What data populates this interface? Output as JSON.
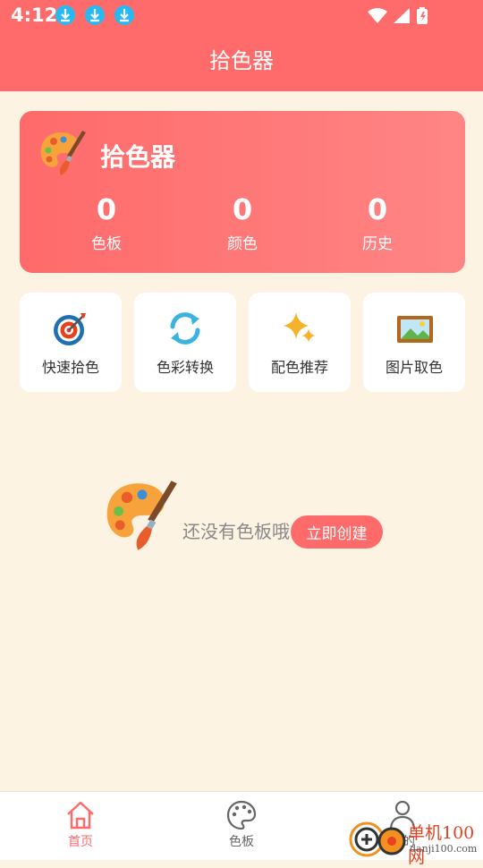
{
  "status_bar": {
    "time": "4:12"
  },
  "app_bar": {
    "title": "拾色器"
  },
  "hero": {
    "title": "拾色器",
    "stats": [
      {
        "value": "0",
        "label": "色板"
      },
      {
        "value": "0",
        "label": "颜色"
      },
      {
        "value": "0",
        "label": "历史"
      }
    ]
  },
  "quick_actions": [
    {
      "label": "快速拾色",
      "icon": "target-icon"
    },
    {
      "label": "色彩转换",
      "icon": "refresh-icon"
    },
    {
      "label": "配色推荐",
      "icon": "sparkle-icon"
    },
    {
      "label": "图片取色",
      "icon": "picture-icon"
    }
  ],
  "empty_state": {
    "text": "还没有色板哦",
    "button": "立即创建"
  },
  "bottom_nav": [
    {
      "label": "首页",
      "active": true
    },
    {
      "label": "色板",
      "active": false
    },
    {
      "label": "我的",
      "active": false
    }
  ],
  "watermark": {
    "text": "单机100网",
    "url": "danji100.com"
  },
  "colors": {
    "primary": "#ff6b6b",
    "background": "#fdf3e3",
    "nav_active": "#ff6b6b",
    "nav_inactive": "#666666"
  }
}
